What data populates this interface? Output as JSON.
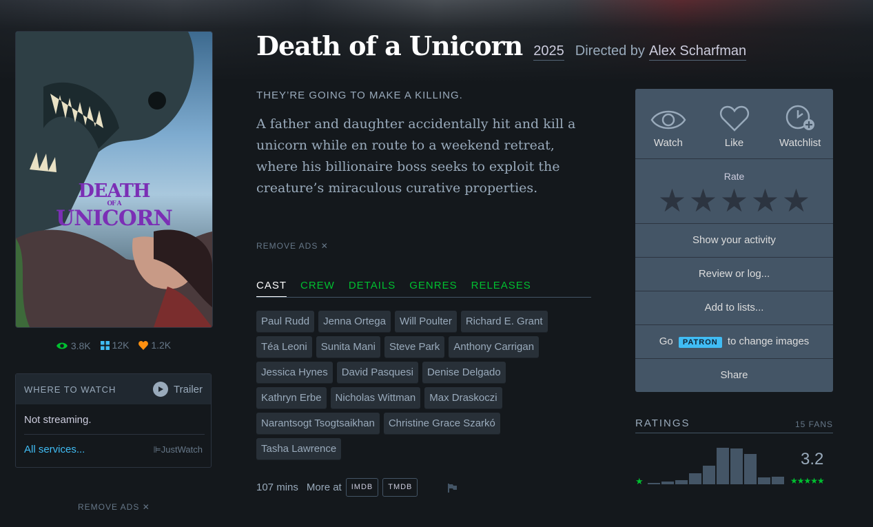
{
  "film": {
    "title": "Death of a Unicorn",
    "year": "2025",
    "directed_by_label": "Directed by",
    "director": "Alex Scharfman",
    "tagline": "THEY’RE GOING TO MAKE A KILLING.",
    "synopsis": "A father and daughter accidentally hit and kill a unicorn while en route to a weekend retreat, where his billionaire boss seeks to exploit the creature’s miraculous curative properties."
  },
  "poster": {
    "line1": "DEATH",
    "line2": "OF A",
    "line3": "UNICORN",
    "title_color": "#7b2fb5"
  },
  "stats": {
    "watched": "3.8K",
    "lists": "12K",
    "likes": "1.2K",
    "watched_icon": "eye-icon",
    "lists_icon": "grid-icon",
    "likes_icon": "heart-icon"
  },
  "where_to_watch": {
    "heading": "WHERE TO WATCH",
    "trailer": "Trailer",
    "status": "Not streaming.",
    "all_services": "All services...",
    "provider": "JustWatch"
  },
  "remove_ads": "REMOVE ADS ✕",
  "tabs": [
    "CAST",
    "CREW",
    "DETAILS",
    "GENRES",
    "RELEASES"
  ],
  "cast": [
    "Paul Rudd",
    "Jenna Ortega",
    "Will Poulter",
    "Richard E. Grant",
    "Téa Leoni",
    "Sunita Mani",
    "Steve Park",
    "Anthony Carrigan",
    "Jessica Hynes",
    "David Pasquesi",
    "Denise Delgado",
    "Kathryn Erbe",
    "Nicholas Wittman",
    "Max Draskoczi",
    "Narantsogt Tsogtsaikhan",
    "Christine Grace Szarkó",
    "Tasha Lawrence"
  ],
  "footer": {
    "runtime": "107 mins",
    "more_at": "More at",
    "imdb": "IMDB",
    "tmdb": "TMDB"
  },
  "actions": {
    "watch": "Watch",
    "like": "Like",
    "watchlist": "Watchlist",
    "rate": "Rate",
    "show_activity": "Show your activity",
    "review": "Review or log...",
    "add_lists": "Add to lists...",
    "go": "Go",
    "patron": "PATRON",
    "change_images": "to change images",
    "share": "Share"
  },
  "ratings": {
    "heading": "RATINGS",
    "fans": "15 FANS",
    "average": "3.2",
    "histogram": [
      0.04,
      0.07,
      0.1,
      0.28,
      0.48,
      0.95,
      0.93,
      0.78,
      0.18,
      0.2
    ]
  },
  "colors": {
    "background": "#14181c",
    "accent_green": "#00c030",
    "accent_blue": "#40bcf4",
    "accent_orange": "#ff9010",
    "panel": "#445566"
  }
}
